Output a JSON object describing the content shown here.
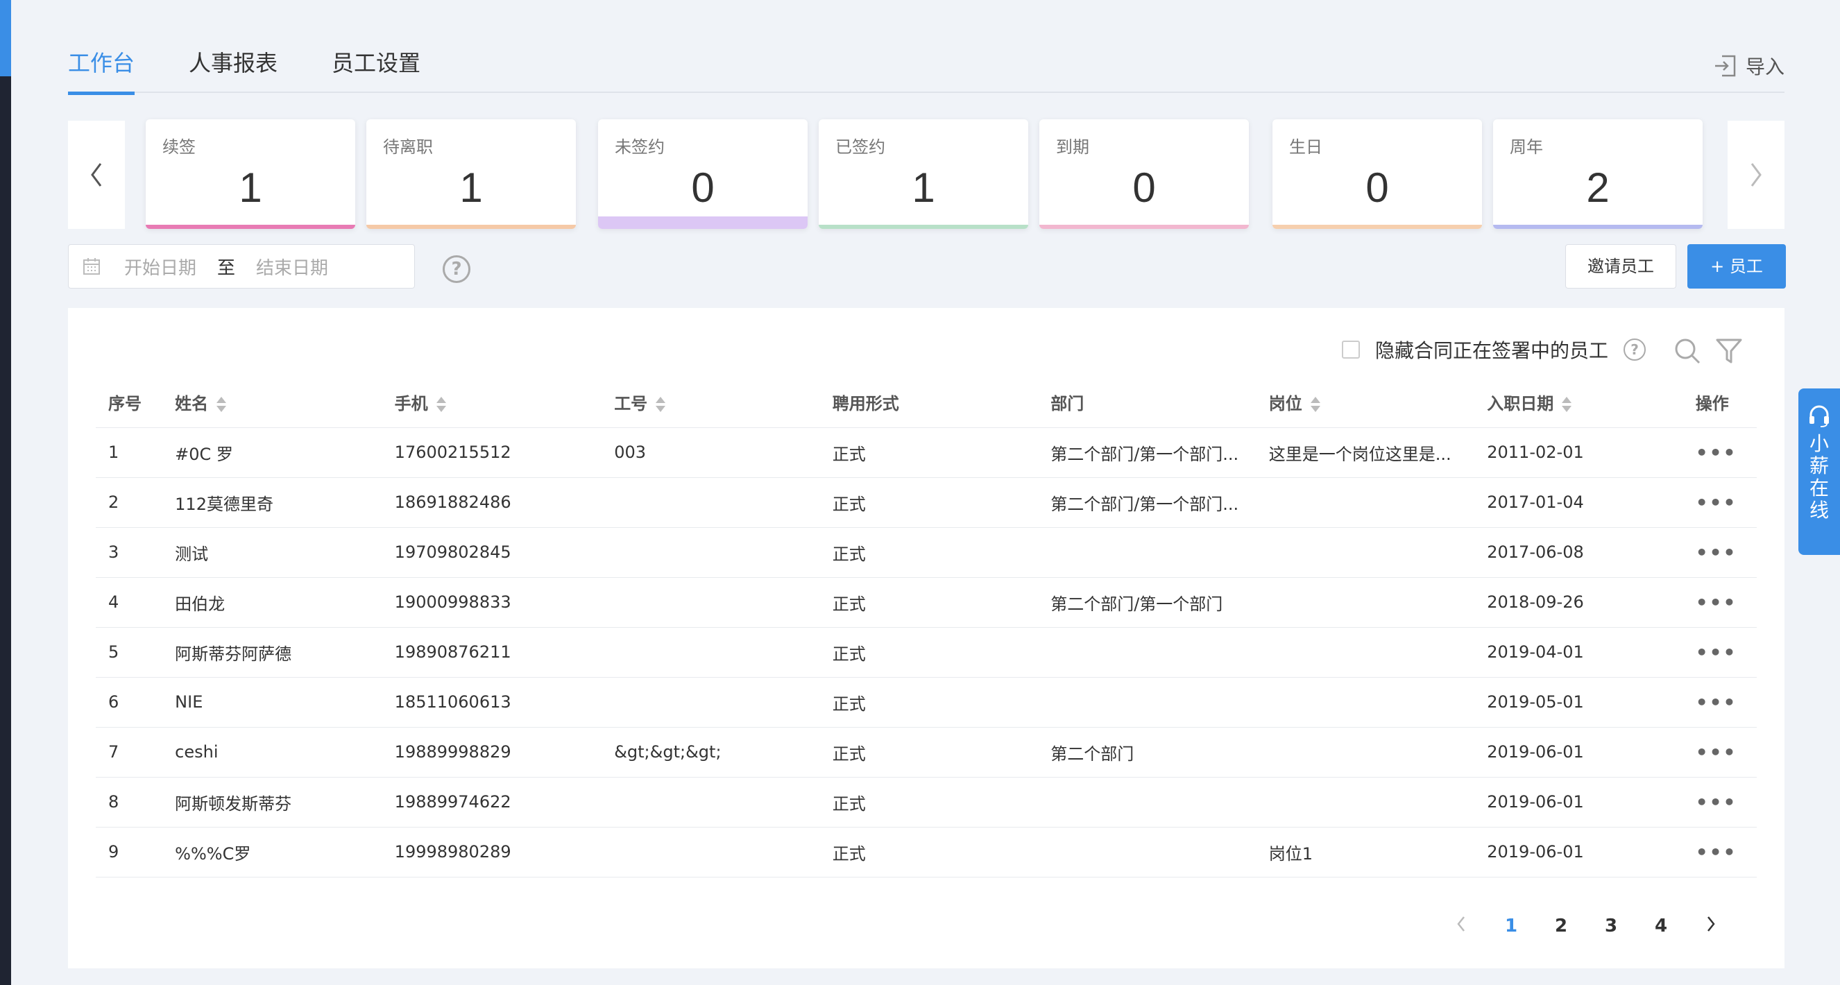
{
  "tabs": [
    {
      "label": "工作台",
      "active": true
    },
    {
      "label": "人事报表",
      "active": false
    },
    {
      "label": "员工设置",
      "active": false
    }
  ],
  "import_label": "导入",
  "stats": [
    {
      "label": "续签",
      "value": "1",
      "color": "#e87bb4"
    },
    {
      "label": "待离职",
      "value": "1",
      "color": "#f5c9a7"
    },
    {
      "label": "未签约",
      "value": "0",
      "color": "#dcc7f5"
    },
    {
      "label": "已签约",
      "value": "1",
      "color": "#b8e0c8"
    },
    {
      "label": "到期",
      "value": "0",
      "color": "#f2b7cf"
    },
    {
      "label": "生日",
      "value": "0",
      "color": "#f6cfae"
    },
    {
      "label": "周年",
      "value": "2",
      "color": "#b5baf0"
    }
  ],
  "date_range": {
    "start_placeholder": "开始日期",
    "separator": "至",
    "end_placeholder": "结束日期"
  },
  "buttons": {
    "invite": "邀请员工",
    "add": "+ 员工"
  },
  "hide_signing_label": "隐藏合同正在签署中的员工",
  "table": {
    "columns": [
      "序号",
      "姓名",
      "手机",
      "工号",
      "聘用形式",
      "部门",
      "岗位",
      "入职日期",
      "操作"
    ],
    "rows": [
      [
        "1",
        "#0C 罗",
        "17600215512",
        "003",
        "正式",
        "第二个部门/第一个部门...",
        "这里是一个岗位这里是...",
        "2011-02-01"
      ],
      [
        "2",
        "112莫德里奇",
        "18691882486",
        "",
        "正式",
        "第二个部门/第一个部门...",
        "",
        "2017-01-04"
      ],
      [
        "3",
        "测试",
        "19709802845",
        "",
        "正式",
        "",
        "",
        "2017-06-08"
      ],
      [
        "4",
        "田伯龙",
        "19000998833",
        "",
        "正式",
        "第二个部门/第一个部门",
        "",
        "2018-09-26"
      ],
      [
        "5",
        "阿斯蒂芬阿萨德",
        "19890876211",
        "",
        "正式",
        "",
        "",
        "2019-04-01"
      ],
      [
        "6",
        "NIE",
        "18511060613",
        "",
        "正式",
        "",
        "",
        "2019-05-01"
      ],
      [
        "7",
        "ceshi",
        "19889998829",
        "&gt;&gt;&gt;",
        "正式",
        "第二个部门",
        "",
        "2019-06-01"
      ],
      [
        "8",
        "阿斯顿发斯蒂芬",
        "19889974622",
        "",
        "正式",
        "",
        "",
        "2019-06-01"
      ],
      [
        "9",
        "%%%C罗",
        "19998980289",
        "",
        "正式",
        "",
        "岗位1",
        "2019-06-01"
      ]
    ],
    "action_label": "•••"
  },
  "pagination": {
    "pages": [
      "1",
      "2",
      "3",
      "4"
    ],
    "current": "1"
  },
  "online_service": "小薪在线"
}
